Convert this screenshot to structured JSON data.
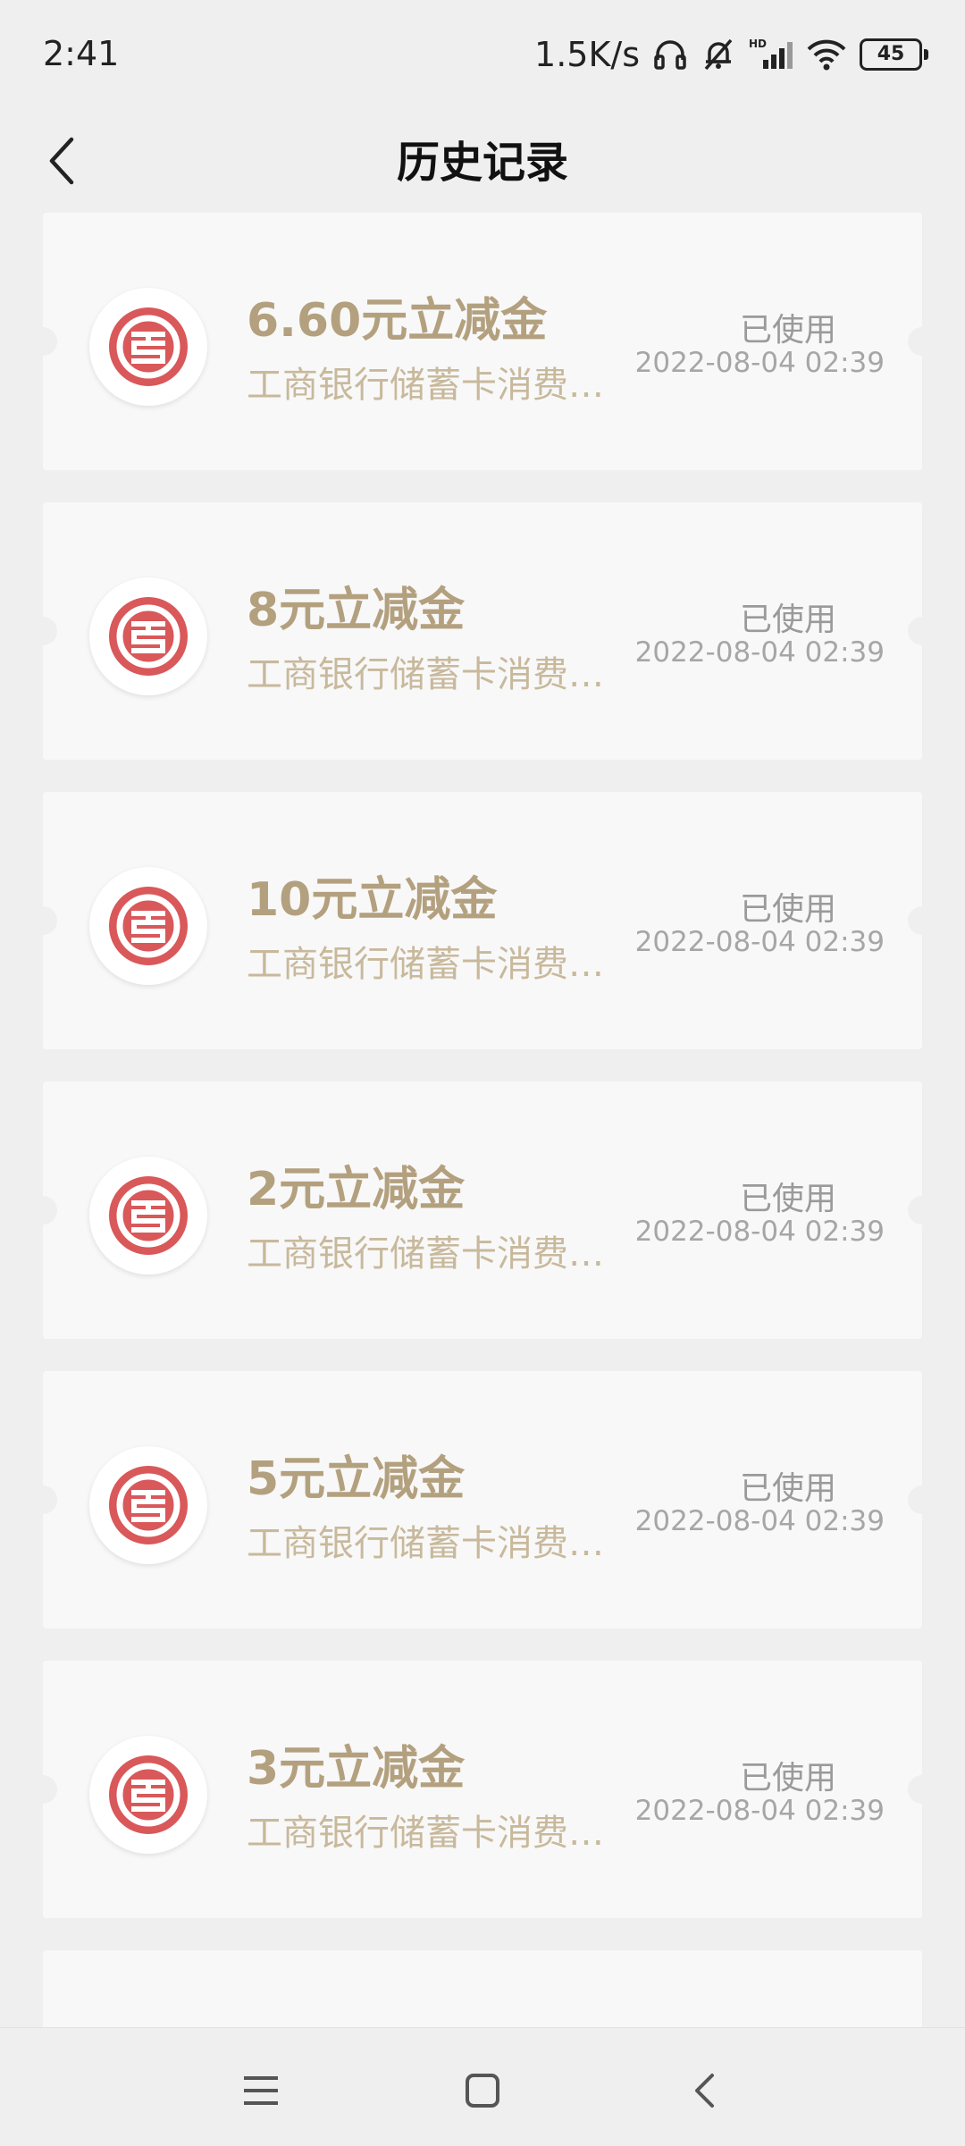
{
  "status_bar": {
    "time": "2:41",
    "net_speed": "1.5K/s",
    "battery": "45",
    "icons": [
      "headphones-icon",
      "mute-bell-icon",
      "hd-signal-icon",
      "wifi-icon",
      "battery-icon"
    ]
  },
  "header": {
    "title": "历史记录",
    "back_icon": "chevron-left-icon"
  },
  "colors": {
    "background": "#efefef",
    "card": "#f8f8f8",
    "amount": "#b3a07e",
    "description": "#c8b99c",
    "status": "#9a9a9a",
    "logo_red": "#d9585a"
  },
  "coupons": [
    {
      "amount": "6.60元立减金",
      "desc": "工商银行储蓄卡消费立减金",
      "status": "已使用",
      "date": "2022-08-04 02:39"
    },
    {
      "amount": "8元立减金",
      "desc": "工商银行储蓄卡消费立减金",
      "status": "已使用",
      "date": "2022-08-04 02:39"
    },
    {
      "amount": "10元立减金",
      "desc": "工商银行储蓄卡消费立减金",
      "status": "已使用",
      "date": "2022-08-04 02:39"
    },
    {
      "amount": "2元立减金",
      "desc": "工商银行储蓄卡消费立减金",
      "status": "已使用",
      "date": "2022-08-04 02:39"
    },
    {
      "amount": "5元立减金",
      "desc": "工商银行储蓄卡消费立减金",
      "status": "已使用",
      "date": "2022-08-04 02:39"
    },
    {
      "amount": "3元立减金",
      "desc": "工商银行储蓄卡消费立减金",
      "status": "已使用",
      "date": "2022-08-04 02:39"
    }
  ],
  "nav_bar": {
    "icons": [
      "menu-icon",
      "home-icon",
      "back-icon"
    ]
  }
}
